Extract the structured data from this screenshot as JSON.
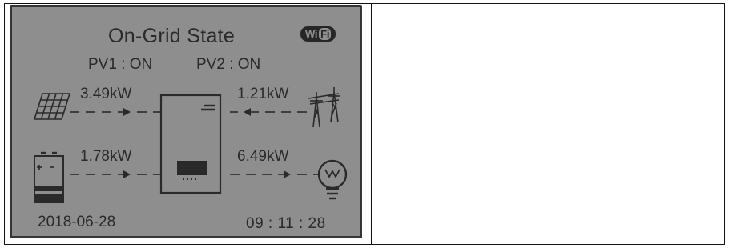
{
  "display": {
    "title": "On-Grid State",
    "wifi_badge": {
      "left": "Wi",
      "right": "Fi"
    },
    "pv1_status": "PV1 : ON",
    "pv2_status": "PV2 : ON",
    "solar_power": "3.49kW",
    "grid_power": "1.21kW",
    "battery_power": "1.78kW",
    "load_power": "6.49kW",
    "date": "2018-06-28",
    "time": "09 : 11 : 28"
  },
  "icons": [
    "solar-panel-icon",
    "grid-tower-icon",
    "battery-icon",
    "light-bulb-icon",
    "inverter-icon",
    "wifi-icon"
  ],
  "colors": {
    "lcd_background": "#8e8e8e",
    "lcd_foreground": "#2a2a2a",
    "lcd_border": "#353535"
  }
}
